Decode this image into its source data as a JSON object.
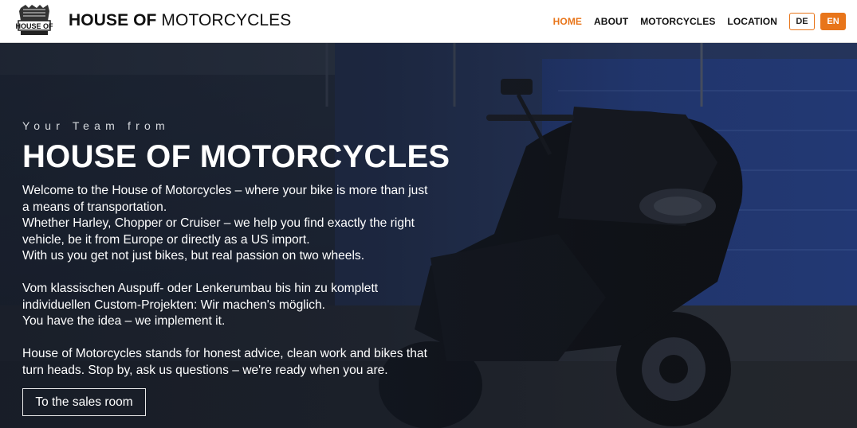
{
  "header": {
    "logo_text": "HOUSE OF",
    "brand_bold": "HOUSE OF",
    "brand_light": "MOTORCYCLES",
    "nav": [
      "HOME",
      "ABOUT",
      "MOTORCYCLES",
      "LOCATION"
    ],
    "active_nav": "HOME",
    "lang_de": "DE",
    "lang_en": "EN"
  },
  "hero": {
    "kicker": "Your Team from",
    "title": "HOUSE OF MOTORCYCLES",
    "paragraph1": [
      "Welcome to the House of Motorcycles – where your bike is more than just",
      "a means of transportation.",
      "Whether Harley, Chopper or Cruiser – we help you find exactly the right",
      "vehicle, be it from Europe or directly as a US import.",
      "With us you get not just bikes, but real passion on two wheels."
    ],
    "paragraph2": [
      "Vom klassischen Auspuff- oder Lenkerumbau bis hin zu komplett",
      "individuellen Custom-Projekten: Wir machen's möglich.",
      "You have the idea – we implement it."
    ],
    "paragraph3": [
      "House of Motorcycles stands for honest advice, clean work and bikes that",
      "turn heads. Stop by, ask us questions – we're ready when you are."
    ],
    "cta_label": "To the sales room"
  },
  "colors": {
    "accent": "#e8751a",
    "header_bg": "#ffffff",
    "hero_text": "#ffffff"
  },
  "icons": {
    "logo": "motorcycle-engine-logo"
  }
}
